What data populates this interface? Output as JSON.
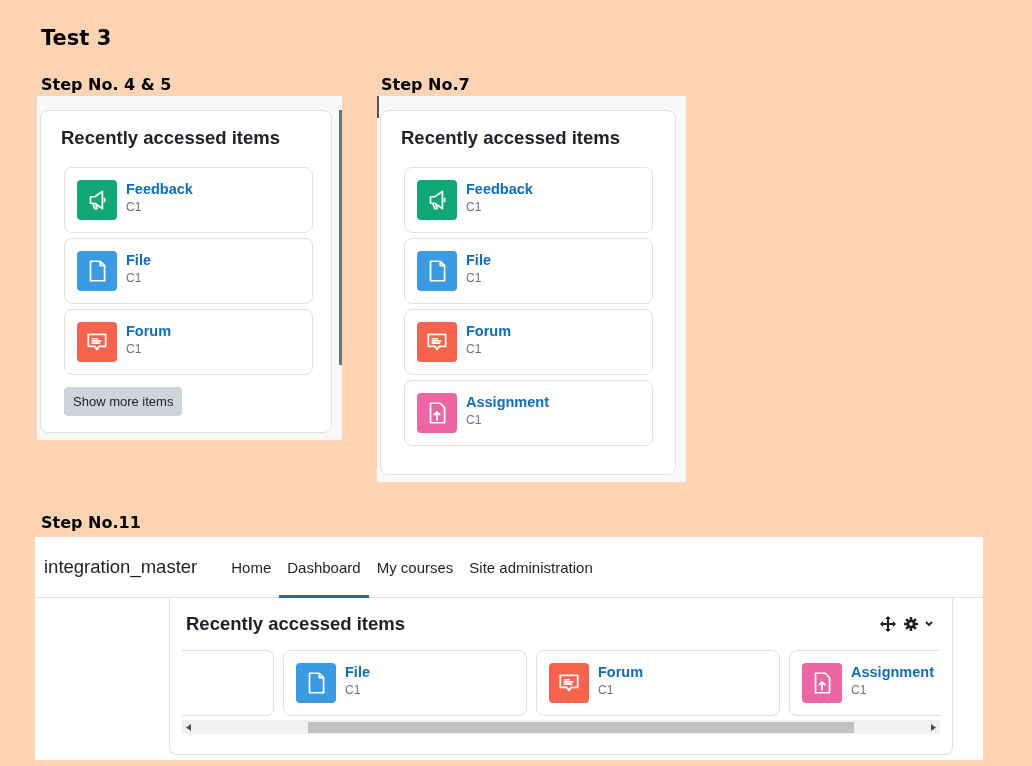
{
  "title": "Test 3",
  "steps": [
    {
      "label": "Step No. 4 & 5",
      "panel": {
        "heading": "Recently accessed items",
        "items": [
          {
            "kind": "feedback",
            "name": "Feedback",
            "course": "C1"
          },
          {
            "kind": "file",
            "name": "File",
            "course": "C1"
          },
          {
            "kind": "forum",
            "name": "Forum",
            "course": "C1"
          }
        ],
        "button": "Show more items"
      }
    },
    {
      "label": "Step No.7",
      "panel": {
        "heading": "Recently accessed items",
        "items": [
          {
            "kind": "feedback",
            "name": "Feedback",
            "course": "C1"
          },
          {
            "kind": "file",
            "name": "File",
            "course": "C1"
          },
          {
            "kind": "forum",
            "name": "Forum",
            "course": "C1"
          },
          {
            "kind": "assignment",
            "name": "Assignment",
            "course": "C1"
          }
        ]
      }
    }
  ],
  "dashboard": {
    "label": "Step No.11",
    "brand": "integration_master",
    "nav": [
      {
        "label": "Home",
        "selected": false
      },
      {
        "label": "Dashboard",
        "selected": true
      },
      {
        "label": "My courses",
        "selected": false
      },
      {
        "label": "Site administration",
        "selected": false
      }
    ],
    "block": {
      "heading": "Recently accessed items",
      "items": [
        {
          "kind": "file",
          "name": "File",
          "course": "C1"
        },
        {
          "kind": "forum",
          "name": "Forum",
          "course": "C1"
        },
        {
          "kind": "assignment",
          "name": "Assignment",
          "course": "C1"
        }
      ]
    }
  }
}
